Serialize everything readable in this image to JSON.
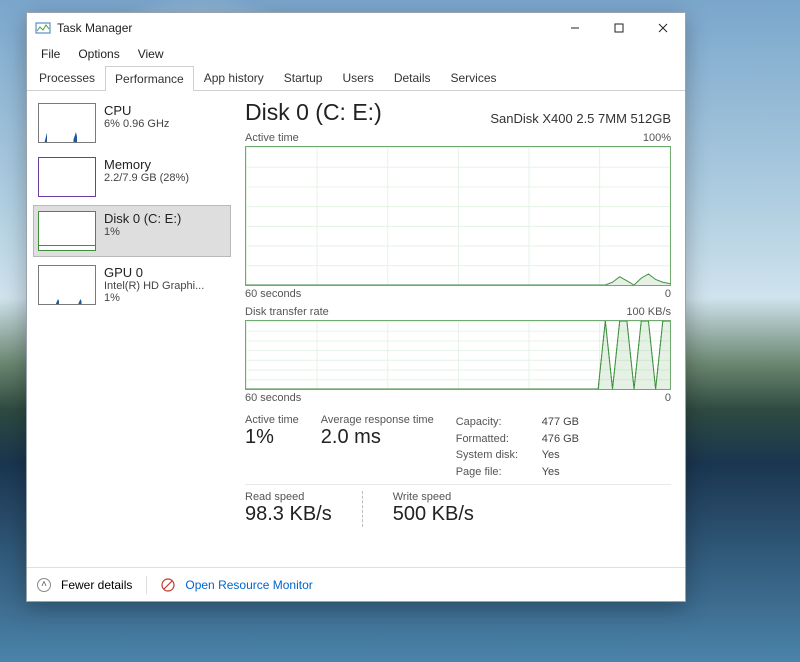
{
  "window": {
    "title": "Task Manager"
  },
  "menu": {
    "file": "File",
    "options": "Options",
    "view": "View"
  },
  "tabs": {
    "processes": "Processes",
    "performance": "Performance",
    "apphistory": "App history",
    "startup": "Startup",
    "users": "Users",
    "details": "Details",
    "services": "Services"
  },
  "sidebar": {
    "cpu": {
      "title": "CPU",
      "sub": "6%  0.96 GHz"
    },
    "memory": {
      "title": "Memory",
      "sub": "2.2/7.9 GB (28%)"
    },
    "disk": {
      "title": "Disk 0 (C: E:)",
      "sub": "1%"
    },
    "gpu": {
      "title": "GPU 0",
      "sub": "Intel(R) HD Graphi...",
      "sub2": "1%"
    }
  },
  "main": {
    "title": "Disk 0 (C: E:)",
    "model": "SanDisk X400 2.5 7MM 512GB",
    "g1": {
      "label": "Active time",
      "max": "100%",
      "xleft": "60 seconds",
      "xright": "0"
    },
    "g2": {
      "label": "Disk transfer rate",
      "max": "100 KB/s",
      "xleft": "60 seconds",
      "xright": "0"
    },
    "stats": {
      "active_time_lbl": "Active time",
      "active_time_val": "1%",
      "art_lbl": "Average response time",
      "art_val": "2.0 ms",
      "read_lbl": "Read speed",
      "read_val": "98.3 KB/s",
      "write_lbl": "Write speed",
      "write_val": "500 KB/s"
    },
    "info": {
      "capacity_k": "Capacity:",
      "capacity_v": "477 GB",
      "formatted_k": "Formatted:",
      "formatted_v": "476 GB",
      "sysdisk_k": "System disk:",
      "sysdisk_v": "Yes",
      "pagefile_k": "Page file:",
      "pagefile_v": "Yes"
    }
  },
  "footer": {
    "fewer": "Fewer details",
    "orm": "Open Resource Monitor"
  },
  "chart_data": [
    {
      "type": "line",
      "title": "Active time",
      "ylabel": "Active time (%)",
      "xlabel": "seconds",
      "ylim": [
        0,
        100
      ],
      "xrange_seconds": [
        60,
        0
      ],
      "series": [
        {
          "name": "Active time %",
          "values": [
            0,
            0,
            0,
            0,
            0,
            0,
            0,
            0,
            0,
            0,
            0,
            0,
            0,
            0,
            0,
            0,
            0,
            0,
            0,
            0,
            0,
            0,
            0,
            0,
            0,
            0,
            0,
            0,
            0,
            0,
            0,
            0,
            0,
            0,
            0,
            0,
            0,
            0,
            0,
            0,
            0,
            0,
            0,
            0,
            0,
            0,
            0,
            0,
            0,
            0,
            0,
            2,
            6,
            3,
            0,
            5,
            8,
            4,
            2,
            1
          ]
        }
      ]
    },
    {
      "type": "line",
      "title": "Disk transfer rate",
      "ylabel": "KB/s",
      "xlabel": "seconds",
      "ylim": [
        0,
        100
      ],
      "xrange_seconds": [
        60,
        0
      ],
      "series": [
        {
          "name": "Read (KB/s)",
          "values": [
            0,
            0,
            0,
            0,
            0,
            0,
            0,
            0,
            0,
            0,
            0,
            0,
            0,
            0,
            0,
            0,
            0,
            0,
            0,
            0,
            0,
            0,
            0,
            0,
            0,
            0,
            0,
            0,
            0,
            0,
            0,
            0,
            0,
            0,
            0,
            0,
            0,
            0,
            0,
            0,
            0,
            0,
            0,
            0,
            0,
            0,
            0,
            0,
            0,
            0,
            100,
            0,
            100,
            100,
            0,
            100,
            100,
            0,
            100,
            100
          ]
        },
        {
          "name": "Write (KB/s)",
          "values": [
            0,
            0,
            0,
            0,
            0,
            0,
            0,
            0,
            0,
            0,
            0,
            0,
            0,
            0,
            0,
            0,
            0,
            0,
            0,
            0,
            0,
            0,
            0,
            0,
            0,
            0,
            0,
            0,
            0,
            0,
            0,
            0,
            0,
            0,
            0,
            0,
            0,
            0,
            0,
            0,
            0,
            0,
            0,
            0,
            0,
            0,
            0,
            0,
            0,
            0,
            100,
            0,
            100,
            100,
            0,
            100,
            100,
            0,
            100,
            100
          ]
        }
      ]
    }
  ]
}
